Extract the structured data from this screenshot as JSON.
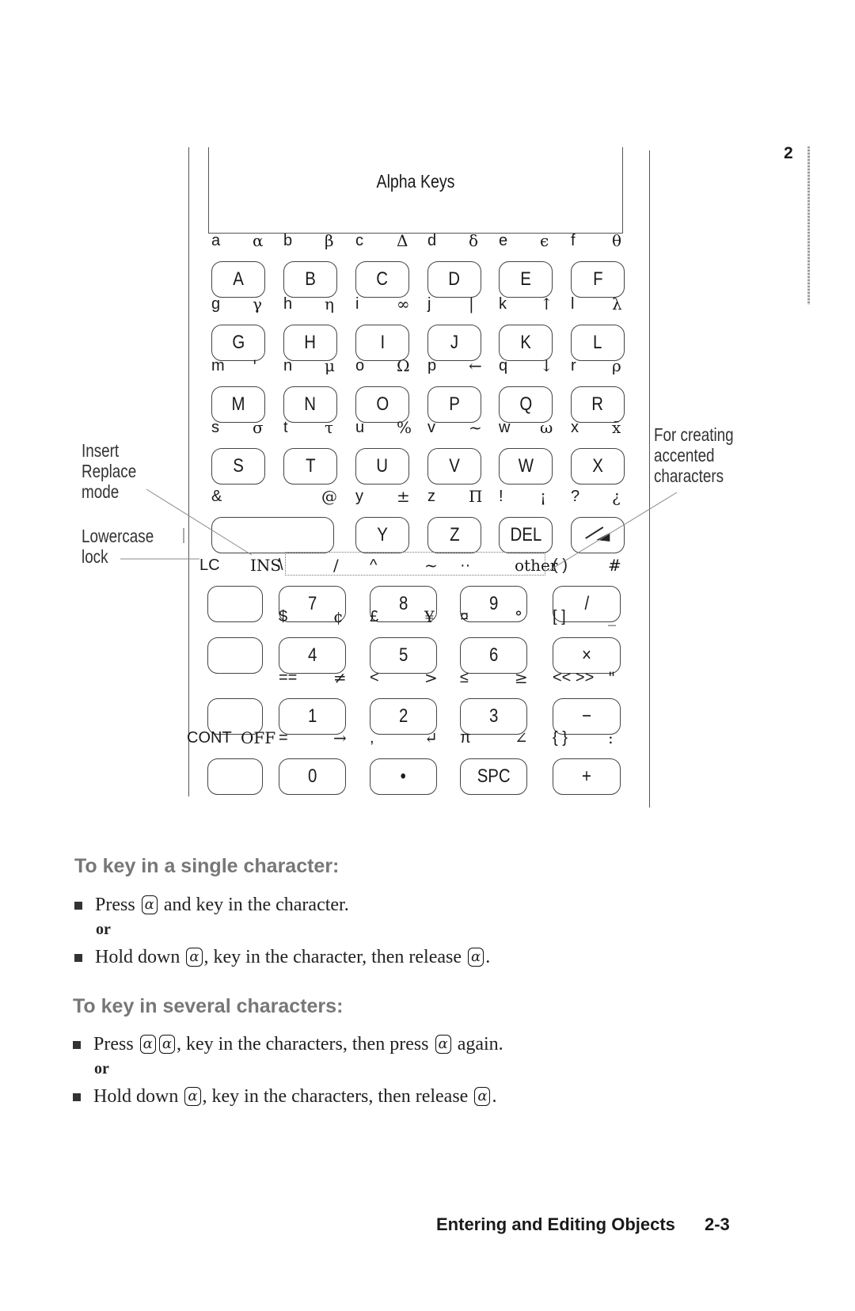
{
  "chapter_number": "2",
  "diagram": {
    "title": "Alpha Keys",
    "rows": [
      {
        "keys": [
          {
            "label": "A",
            "lower": "a",
            "shift": "α"
          },
          {
            "label": "B",
            "lower": "b",
            "shift": "β"
          },
          {
            "label": "C",
            "lower": "c",
            "shift": "Δ"
          },
          {
            "label": "D",
            "lower": "d",
            "shift": "δ"
          },
          {
            "label": "E",
            "lower": "e",
            "shift": "ϵ"
          },
          {
            "label": "F",
            "lower": "f",
            "shift": "θ"
          }
        ]
      },
      {
        "keys": [
          {
            "label": "G",
            "lower": "g",
            "shift": "γ"
          },
          {
            "label": "H",
            "lower": "h",
            "shift": "η"
          },
          {
            "label": "I",
            "lower": "i",
            "shift": "∞"
          },
          {
            "label": "J",
            "lower": "j",
            "shift": "|"
          },
          {
            "label": "K",
            "lower": "k",
            "shift": "↑"
          },
          {
            "label": "L",
            "lower": "l",
            "shift": "λ"
          }
        ]
      },
      {
        "keys": [
          {
            "label": "M",
            "lower": "m",
            "shift": "'"
          },
          {
            "label": "N",
            "lower": "n",
            "shift": "μ"
          },
          {
            "label": "O",
            "lower": "o",
            "shift": "Ω"
          },
          {
            "label": "P",
            "lower": "p",
            "shift": "←"
          },
          {
            "label": "Q",
            "lower": "q",
            "shift": "↓"
          },
          {
            "label": "R",
            "lower": "r",
            "shift": "ρ"
          }
        ]
      },
      {
        "keys": [
          {
            "label": "S",
            "lower": "s",
            "shift": "σ"
          },
          {
            "label": "T",
            "lower": "t",
            "shift": "τ"
          },
          {
            "label": "U",
            "lower": "u",
            "shift": "%"
          },
          {
            "label": "V",
            "lower": "v",
            "shift": "~"
          },
          {
            "label": "W",
            "lower": "w",
            "shift": "ω"
          },
          {
            "label": "X",
            "lower": "x",
            "shift": "x̄"
          }
        ]
      },
      {
        "keys": [
          {
            "label": "",
            "lower": "&",
            "shift": "@"
          },
          {
            "label": "Y",
            "lower": "y",
            "shift": "±"
          },
          {
            "label": "Z",
            "lower": "z",
            "shift": "Π"
          },
          {
            "label": "DEL",
            "lower": "!",
            "shift": "¡"
          },
          {
            "label": "backspace",
            "lower": "?",
            "shift": "¿"
          }
        ]
      },
      {
        "keys": [
          {
            "label": "",
            "lower": "LC",
            "shift": "INS"
          },
          {
            "label": "7",
            "lower": "\\",
            "shift": "/"
          },
          {
            "label": "8",
            "lower": "^",
            "shift": "~"
          },
          {
            "label": "9",
            "lower": "··",
            "shift": "other"
          },
          {
            "label": "/",
            "lower": "( )",
            "shift": "#"
          }
        ]
      },
      {
        "keys": [
          {
            "label": "",
            "lower": "",
            "shift": ""
          },
          {
            "label": "4",
            "lower": "$",
            "shift": "¢"
          },
          {
            "label": "5",
            "lower": "£",
            "shift": "¥"
          },
          {
            "label": "6",
            "lower": "¤",
            "shift": "°"
          },
          {
            "label": "×",
            "lower": "[ ]",
            "shift": "_"
          }
        ]
      },
      {
        "keys": [
          {
            "label": "",
            "lower": "",
            "shift": ""
          },
          {
            "label": "1",
            "lower": "==",
            "shift": "≠"
          },
          {
            "label": "2",
            "lower": "<",
            "shift": ">"
          },
          {
            "label": "3",
            "lower": "≤",
            "shift": "≥"
          },
          {
            "label": "−",
            "lower": "<< >>",
            "shift": "\""
          }
        ]
      },
      {
        "keys": [
          {
            "label": "",
            "lower": "CONT",
            "shift": "OFF"
          },
          {
            "label": "0",
            "lower": "=",
            "shift": "→"
          },
          {
            "label": "•",
            "lower": ",",
            "shift": "↵"
          },
          {
            "label": "SPC",
            "lower": "π",
            "shift": "∠"
          },
          {
            "label": "+",
            "lower": "{ }",
            "shift": ":"
          }
        ]
      }
    ],
    "callouts": {
      "insert_replace": [
        "Insert",
        "Replace",
        "mode"
      ],
      "lowercase_lock": [
        "Lowercase",
        "lock"
      ],
      "accented": [
        "For creating",
        "accented",
        "characters"
      ]
    }
  },
  "section_single": {
    "heading": "To key in a single character:",
    "items": [
      {
        "before": "Press ",
        "key": "α",
        "after": " and key in the character."
      },
      {
        "before": "Hold down ",
        "key": "α",
        "middle": ", key in the character, then release ",
        "key2": "α",
        "after": "."
      }
    ],
    "or": "or"
  },
  "section_several": {
    "heading": "To key in several characters:",
    "items": [
      {
        "before": "Press ",
        "key": "α",
        "key_b": "α",
        "middle": ", key in the characters, then press ",
        "key2": "α",
        "after": " again."
      },
      {
        "before": "Hold down ",
        "key": "α",
        "middle": ", key in the characters, then release ",
        "key2": "α",
        "after": "."
      }
    ],
    "or": "or"
  },
  "footer": {
    "title": "Entering and Editing Objects",
    "page": "2-3"
  }
}
